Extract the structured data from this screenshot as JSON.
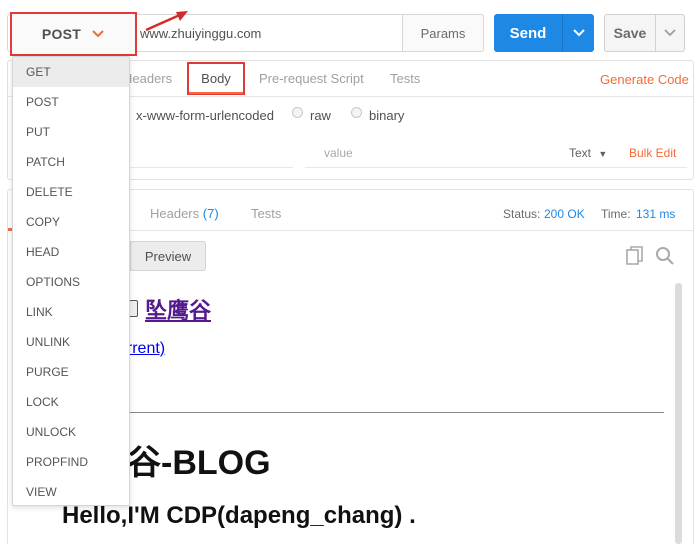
{
  "request": {
    "method": "POST",
    "url": "www.zhuiyinggu.com",
    "params_label": "Params",
    "send_label": "Send",
    "save_label": "Save"
  },
  "request_tabs": {
    "headers": "Headers",
    "body": "Body",
    "prerequest": "Pre-request Script",
    "tests": "Tests",
    "generate_code": "Generate Code"
  },
  "body_options": {
    "urlencoded": "x-www-form-urlencoded",
    "raw": "raw",
    "binary": "binary"
  },
  "kv_editor": {
    "value_placeholder": "value",
    "text_type": "Text",
    "bulk_edit": "Bulk Edit"
  },
  "response": {
    "headers_label": "Headers",
    "headers_count": "(7)",
    "tests_label": "Tests",
    "status_label": "Status:",
    "status_value": "200 OK",
    "time_label": "Time:",
    "time_value": "131 ms",
    "preview_label": "Preview"
  },
  "preview_content": {
    "site_link": "坠鹰谷",
    "current_link": "urrent)",
    "blog_title": "谷-BLOG",
    "hello": "Hello,I'M CDP(dapeng_chang) ."
  },
  "method_menu": {
    "items": [
      "GET",
      "POST",
      "PUT",
      "PATCH",
      "DELETE",
      "COPY",
      "HEAD",
      "OPTIONS",
      "LINK",
      "UNLINK",
      "PURGE",
      "LOCK",
      "UNLOCK",
      "PROPFIND",
      "VIEW"
    ],
    "active_index": 0
  },
  "colors": {
    "accent": "#f26b3a",
    "send": "#1e88e5",
    "highlight_box": "#e03a3a"
  }
}
